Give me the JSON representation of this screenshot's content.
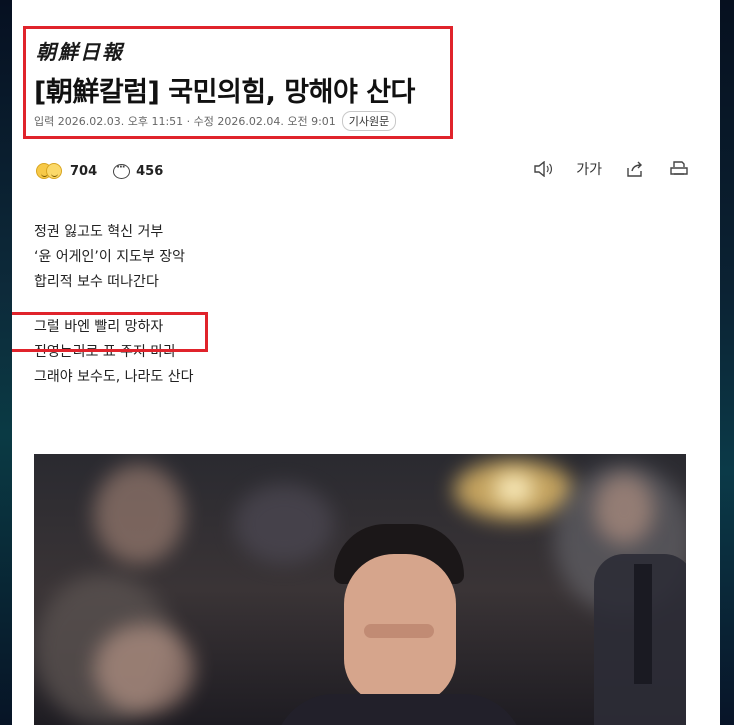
{
  "masthead": "朝鮮日報",
  "headline": "[朝鮮칼럼] 국민의힘, 망해야 산다",
  "meta": {
    "dates": "입력 2026.02.03. 오후 11:51 · 수정 2026.02.04. 오전 9:01",
    "original_button": "기사원문"
  },
  "reactions": {
    "reaction_count": "704",
    "comment_count": "456"
  },
  "tools": {
    "speaker": "speaker-icon",
    "font_size_label": "가가",
    "share": "share-icon",
    "print": "print-icon"
  },
  "lede": {
    "line1": "정권 잃고도 혁신 거부",
    "line2": "‘윤 어게인’이 지도부 장악",
    "line3": "합리적 보수 떠나간다",
    "line4": "그럴 바엔 빨리 망하자",
    "line5": "진영논리로 표 주지 마라",
    "line6": "그래야 보수도, 나라도 산다"
  },
  "colors": {
    "highlight_box": "#e0232b",
    "background": "#0b1a2a"
  }
}
